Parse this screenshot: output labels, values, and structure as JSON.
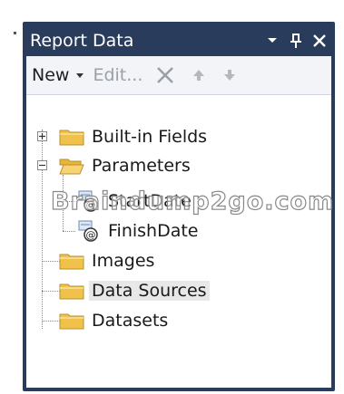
{
  "panel": {
    "title": "Report Data",
    "accent": "#2a3c5c"
  },
  "toolbar": {
    "new_label": "New",
    "edit_label": "Edit...",
    "icons": [
      "delete-icon",
      "move-up-icon",
      "move-down-icon"
    ]
  },
  "tree": {
    "builtin_fields": "Built-in Fields",
    "parameters": "Parameters",
    "param_start": "StartDate",
    "param_finish": "FinishDate",
    "images": "Images",
    "data_sources": "Data Sources",
    "datasets": "Datasets"
  },
  "watermark": "Braindump2go.com"
}
